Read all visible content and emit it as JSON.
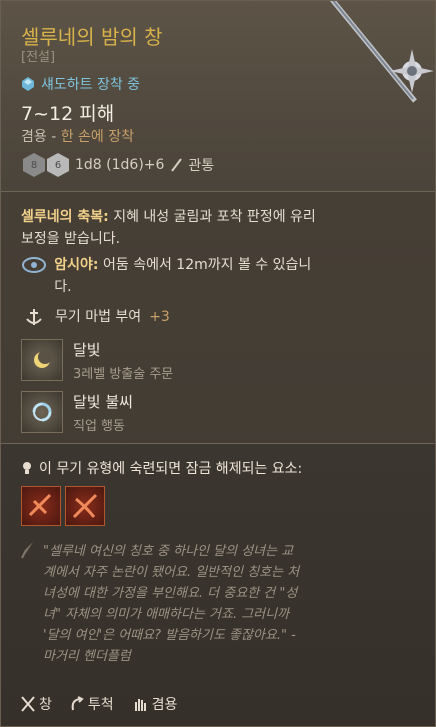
{
  "item": {
    "title": "셀루네의 밤의 창",
    "rarity": "[전설]",
    "requirement": "섀도하트 장착 중",
    "damage": "7~12 피해",
    "usage_prefix": "겸용 - ",
    "usage_accent": "한 손에 장착",
    "dice_text": "1d8 (1d6)+6",
    "damage_type": "관통"
  },
  "blessing": {
    "title": "셀루네의 축복:",
    "text": " 지혜 내성 굴림과 포착 판정에 유리 보정을 받습니다."
  },
  "darkvision": {
    "title": "암시야:",
    "text": " 어둠 속에서 12m까지 볼 수 있습니다."
  },
  "enchant": {
    "label": "무기 마법 부여",
    "value": "+3"
  },
  "spells": [
    {
      "name": "달빛",
      "sub": "3레벨 방출술 주문"
    },
    {
      "name": "달빛 불씨",
      "sub": "직업 행동"
    }
  ],
  "unlock": "이 무기 유형에 숙련되면 잠금 해제되는 요소:",
  "quote": "\"셀루네 여신의 칭호 중 하나인 달의 성녀는 교계에서 자주 논란이 됐어요. 일반적인 칭호는 처녀성에 대한 가정을 부인해요. 더 중요한 건 \"성녀\" 자체의 의미가 애매하다는 거죠. 그러니까 '달의 여인'은 어때요? 발음하기도 좋잖아요.\" - 마거리 헨더플럼",
  "properties": [
    "창",
    "투척",
    "겸용"
  ],
  "colors": {
    "title": "#d9b24a",
    "requirement": "#7ec3dc",
    "accent": "#c9a06a",
    "enchant": "#c9a06a"
  }
}
